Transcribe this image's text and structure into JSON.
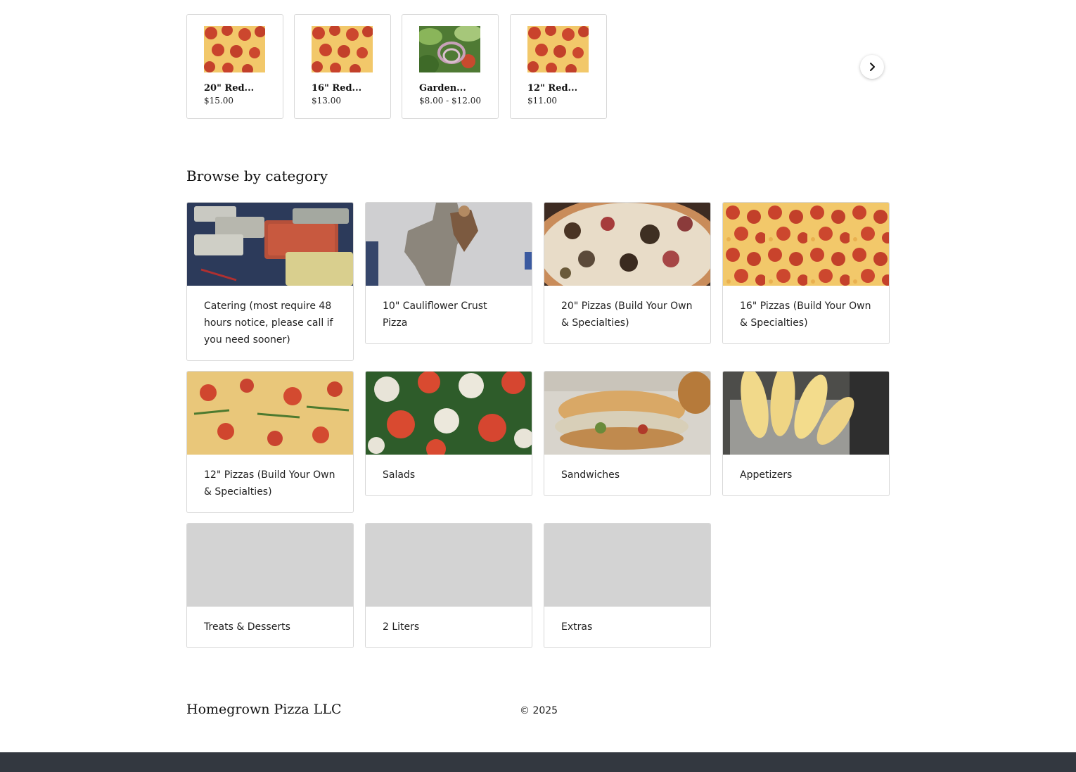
{
  "featured": [
    {
      "name": "20\" Red...",
      "price": "$15.00",
      "image": "pepperoni-pizza"
    },
    {
      "name": "16\" Red...",
      "price": "$13.00",
      "image": "pepperoni-pizza"
    },
    {
      "name": "Garden...",
      "price": "$8.00 - $12.00",
      "image": "garden-salad"
    },
    {
      "name": "12\" Red...",
      "price": "$11.00",
      "image": "pepperoni-pizza"
    }
  ],
  "carousel": {
    "next_icon": "chevron-right-icon"
  },
  "browse": {
    "title": "Browse by category",
    "categories": [
      {
        "label": "Catering (most require 48 hours notice, please call if you need sooner)",
        "image": "catering-trays"
      },
      {
        "label": "10\" Cauliflower Crust Pizza",
        "image": "wood-state-sign"
      },
      {
        "label": "20\" Pizzas (Build Your Own & Specialties)",
        "image": "specialty-pizza"
      },
      {
        "label": "16\" Pizzas (Build Your Own & Specialties)",
        "image": "pepperoni-pizza"
      },
      {
        "label": "12\" Pizzas (Build Your Own & Specialties)",
        "image": "tomato-pizza"
      },
      {
        "label": "Salads",
        "image": "caprese-salad"
      },
      {
        "label": "Sandwiches",
        "image": "sandwich"
      },
      {
        "label": "Appetizers",
        "image": "breadsticks"
      },
      {
        "label": "Treats & Desserts",
        "image": "none"
      },
      {
        "label": "2 Liters",
        "image": "none"
      },
      {
        "label": "Extras",
        "image": "none"
      }
    ]
  },
  "footer": {
    "brand": "Homegrown Pizza LLC",
    "copyright": "© 2025"
  },
  "colors": {
    "bottom_bar": "#333840",
    "card_border": "#d8d8d8",
    "placeholder": "#d3d3d3"
  }
}
